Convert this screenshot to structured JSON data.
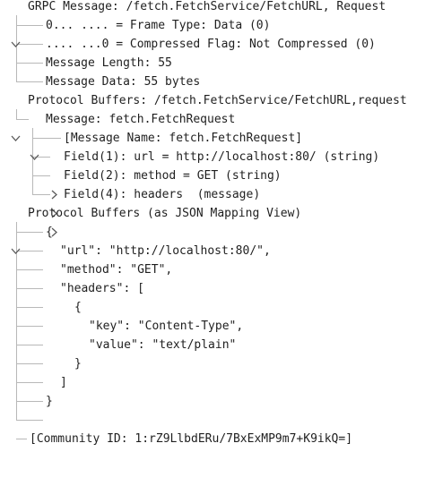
{
  "tree": {
    "grpc_message": {
      "header": "GRPC Message: /fetch.FetchService/FetchURL, Request",
      "frame_type": "0... .... = Frame Type: Data (0)",
      "compressed_flag": ".... ...0 = Compressed Flag: Not Compressed (0)",
      "message_length": "Message Length: 55",
      "message_data": "Message Data: 55 bytes"
    },
    "protobuf": {
      "header": "Protocol Buffers: /fetch.FetchService/FetchURL,request",
      "message": {
        "header": "Message: fetch.FetchRequest",
        "message_name": "[Message Name: fetch.FetchRequest]",
        "fields": [
          "Field(1): url = http://localhost:80/ (string)",
          "Field(2): method = GET (string)",
          "Field(4): headers  (message)"
        ]
      }
    },
    "json_view": {
      "header": "Protocol Buffers (as JSON Mapping View)",
      "lines": [
        "{",
        "\"url\": \"http://localhost:80/\",",
        "\"method\": \"GET\",",
        "\"headers\": [",
        "{",
        "\"key\": \"Content-Type\",",
        "\"value\": \"text/plain\"",
        "}",
        "]",
        "}"
      ]
    },
    "community_id": "[Community ID: 1:rZ9LlbdERu/7BxExMP9m7+K9ikQ=]"
  }
}
